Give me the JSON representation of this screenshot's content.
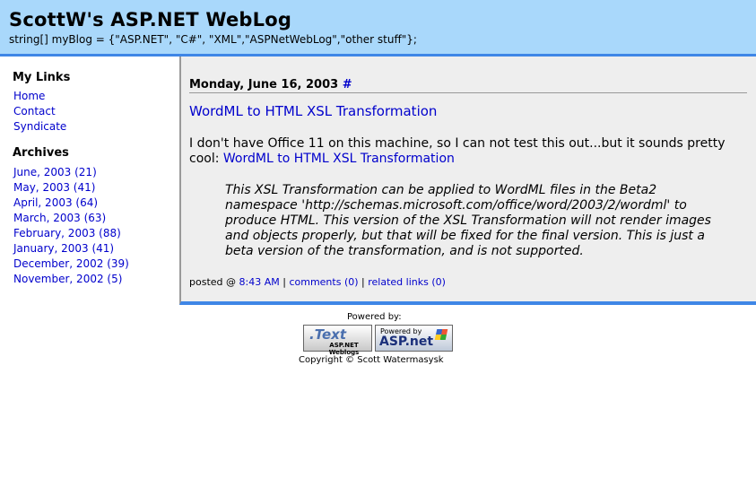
{
  "header": {
    "title": "ScottW's ASP.NET WebLog",
    "subtitle": "string[] myBlog = {\"ASP.NET\", \"C#\", \"XML\",\"ASPNetWebLog\",\"other stuff\"};"
  },
  "sidebar": {
    "links_heading": "My Links",
    "links": [
      {
        "label": "Home"
      },
      {
        "label": "Contact"
      },
      {
        "label": "Syndicate"
      }
    ],
    "archives_heading": "Archives",
    "archives": [
      {
        "label": "June, 2003 (21)"
      },
      {
        "label": "May, 2003 (41)"
      },
      {
        "label": "April, 2003 (64)"
      },
      {
        "label": "March, 2003 (63)"
      },
      {
        "label": "February, 2003 (88)"
      },
      {
        "label": "January, 2003 (41)"
      },
      {
        "label": "December, 2002 (39)"
      },
      {
        "label": "November, 2002 (5)"
      }
    ]
  },
  "post": {
    "date": "Monday, June 16, 2003",
    "date_anchor": "#",
    "title": "WordML to HTML XSL Transformation",
    "body_text": "I don't have Office 11 on this machine, so I can not test this out...but it sounds pretty cool:",
    "body_link": "WordML to HTML XSL Transformation",
    "quote": "This XSL Transformation can be applied to WordML files in the Beta2 namespace 'http://schemas.microsoft.com/office/word/2003/2/wordml' to produce HTML. This version of the XSL Transformation will not render images and objects properly, but that will be fixed for the final version. This is just a beta version of the transformation, and is not supported.",
    "footer_prefix": "posted @",
    "time": "8:43 AM",
    "separator": "|",
    "comments": "comments (0)",
    "related": "related links (0)"
  },
  "footer": {
    "powered_by": "Powered by:",
    "badge_text_logo": ".Text",
    "badge_text_sub": "ASP.NET Weblogs",
    "badge_asp_top": "Powered by",
    "badge_asp_main": "ASP.net",
    "copyright": "Copyright © Scott Watermasysk"
  },
  "colors": {
    "header_bg": "#a9d8fb",
    "accent_border": "#3f86e6",
    "main_bg": "#eeeeee",
    "link": "#0000cc"
  }
}
